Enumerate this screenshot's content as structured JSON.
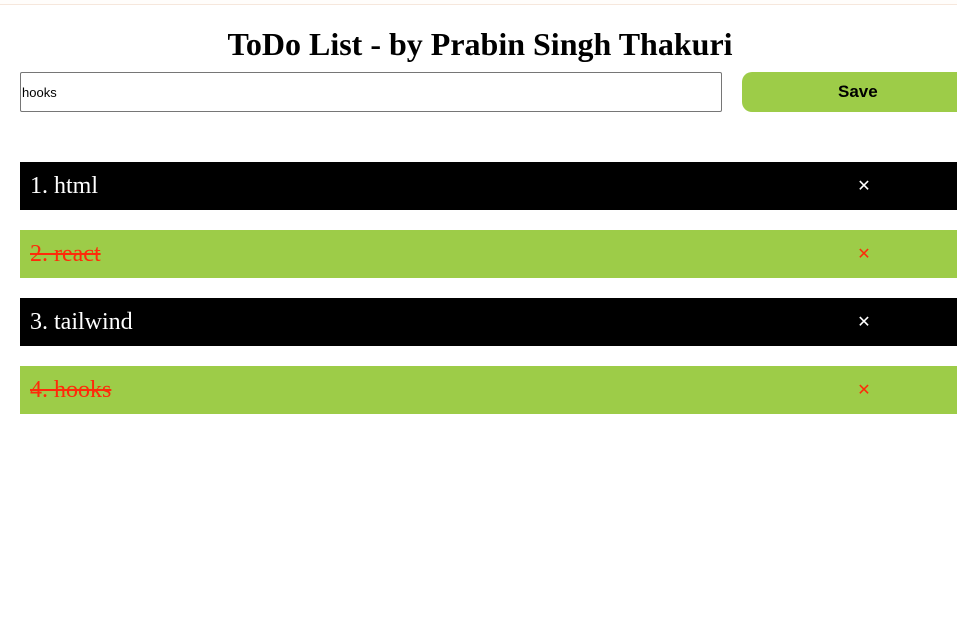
{
  "header": {
    "title": "ToDo List - by Prabin Singh Thakuri"
  },
  "input": {
    "value": "hooks"
  },
  "save_button": {
    "label": "Save"
  },
  "todos": [
    {
      "text": "1. html",
      "completed": false
    },
    {
      "text": "2. react",
      "completed": true
    },
    {
      "text": "3. tailwind",
      "completed": false
    },
    {
      "text": "4. hooks",
      "completed": true
    }
  ],
  "delete_icon": "close-icon",
  "colors": {
    "accent_green": "#9dcc48",
    "active_row_bg": "#000000",
    "active_row_text": "#ffffff",
    "completed_text": "#ff2a0a"
  }
}
